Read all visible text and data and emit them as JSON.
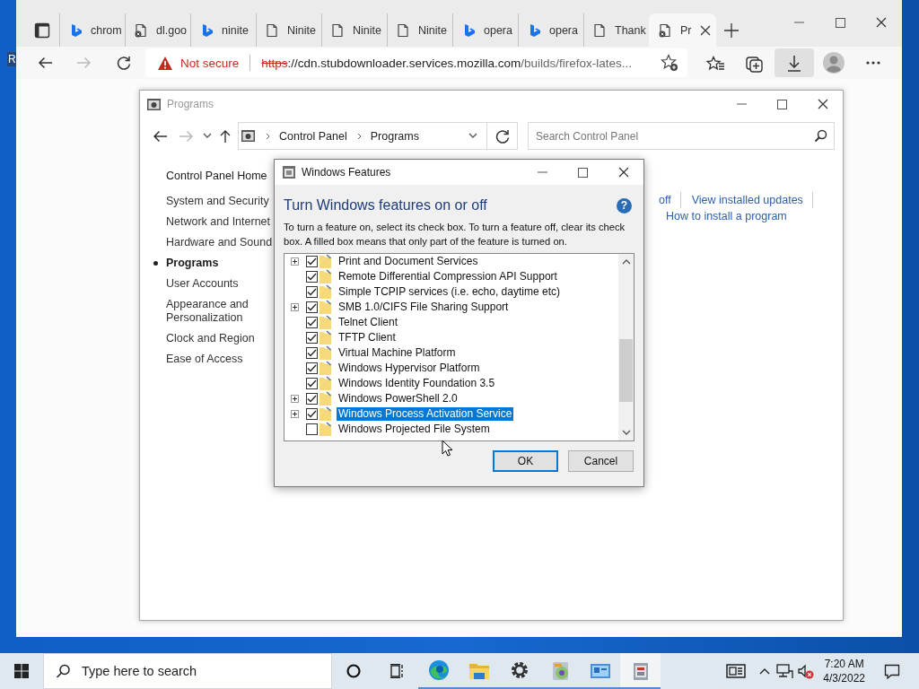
{
  "desktop": {
    "icon_label": "R"
  },
  "browser": {
    "tabs": [
      {
        "title": "chrom",
        "kind": "logo",
        "selected": false
      },
      {
        "title": "dl.goo",
        "kind": "blocked",
        "selected": false
      },
      {
        "title": "ninite",
        "kind": "logo",
        "selected": false
      },
      {
        "title": "Ninite",
        "kind": "page",
        "selected": false
      },
      {
        "title": "Ninite",
        "kind": "page",
        "selected": false
      },
      {
        "title": "Ninite",
        "kind": "page",
        "selected": false
      },
      {
        "title": "opera",
        "kind": "logo",
        "selected": false
      },
      {
        "title": "opera",
        "kind": "logo",
        "selected": false
      },
      {
        "title": "Thank",
        "kind": "page",
        "selected": false
      },
      {
        "title": "Pr",
        "kind": "blocked",
        "selected": true
      }
    ],
    "security": "Not secure",
    "url": {
      "scheme": "https",
      "host": "://cdn.stubdownloader.services.mozilla.com",
      "path": "/builds/firefox-lates..."
    },
    "downloads_open": true
  },
  "control_panel": {
    "title": "Programs",
    "breadcrumb": [
      "Control Panel",
      "Programs"
    ],
    "search_placeholder": "Search Control Panel",
    "home_link": "Control Panel Home",
    "nav": [
      {
        "label": "System and Security",
        "selected": false
      },
      {
        "label": "Network and Internet",
        "selected": false
      },
      {
        "label": "Hardware and Sound",
        "selected": false
      },
      {
        "label": "Programs",
        "selected": true
      },
      {
        "label": "User Accounts",
        "selected": false
      },
      {
        "label": "Appearance and Personalization",
        "selected": false
      },
      {
        "label": "Clock and Region",
        "selected": false
      },
      {
        "label": "Ease of Access",
        "selected": false
      }
    ],
    "link_rows": [
      {
        "links": [
          "off",
          "View installed updates"
        ]
      },
      {
        "links": [
          "How to install a program"
        ]
      }
    ]
  },
  "dialog": {
    "title": "Windows Features",
    "heading": "Turn Windows features on or off",
    "help_button": "?",
    "description": "To turn a feature on, select its check box. To turn a feature off, clear its check box. A filled box means that only part of the feature is turned on.",
    "features": [
      {
        "label": "Print and Document Services",
        "expandable": true,
        "checked": true,
        "selected": false
      },
      {
        "label": "Remote Differential Compression API Support",
        "expandable": false,
        "checked": true,
        "selected": false
      },
      {
        "label": "Simple TCPIP services (i.e. echo, daytime etc)",
        "expandable": false,
        "checked": true,
        "selected": false
      },
      {
        "label": "SMB 1.0/CIFS File Sharing Support",
        "expandable": true,
        "checked": true,
        "selected": false
      },
      {
        "label": "Telnet Client",
        "expandable": false,
        "checked": true,
        "selected": false
      },
      {
        "label": "TFTP Client",
        "expandable": false,
        "checked": true,
        "selected": false
      },
      {
        "label": "Virtual Machine Platform",
        "expandable": false,
        "checked": true,
        "selected": false
      },
      {
        "label": "Windows Hypervisor Platform",
        "expandable": false,
        "checked": true,
        "selected": false
      },
      {
        "label": "Windows Identity Foundation 3.5",
        "expandable": false,
        "checked": true,
        "selected": false
      },
      {
        "label": "Windows PowerShell 2.0",
        "expandable": true,
        "checked": true,
        "selected": false
      },
      {
        "label": "Windows Process Activation Service",
        "expandable": true,
        "checked": true,
        "selected": true
      },
      {
        "label": "Windows Projected File System",
        "expandable": false,
        "checked": false,
        "selected": false
      }
    ],
    "buttons": [
      {
        "label": "OK",
        "default": true
      },
      {
        "label": "Cancel",
        "default": false
      }
    ]
  },
  "taskbar": {
    "search_placeholder": "Type here to search",
    "apps": [
      {
        "kind": "edge",
        "running": true,
        "focused": false
      },
      {
        "kind": "folder",
        "running": true,
        "focused": false
      },
      {
        "kind": "gear",
        "running": true,
        "focused": false
      },
      {
        "kind": "media",
        "running": true,
        "focused": false
      },
      {
        "kind": "monitor",
        "running": true,
        "focused": false
      },
      {
        "kind": "installer",
        "running": true,
        "focused": true
      }
    ],
    "time": "7:20 AM",
    "date": "4/3/2022"
  }
}
